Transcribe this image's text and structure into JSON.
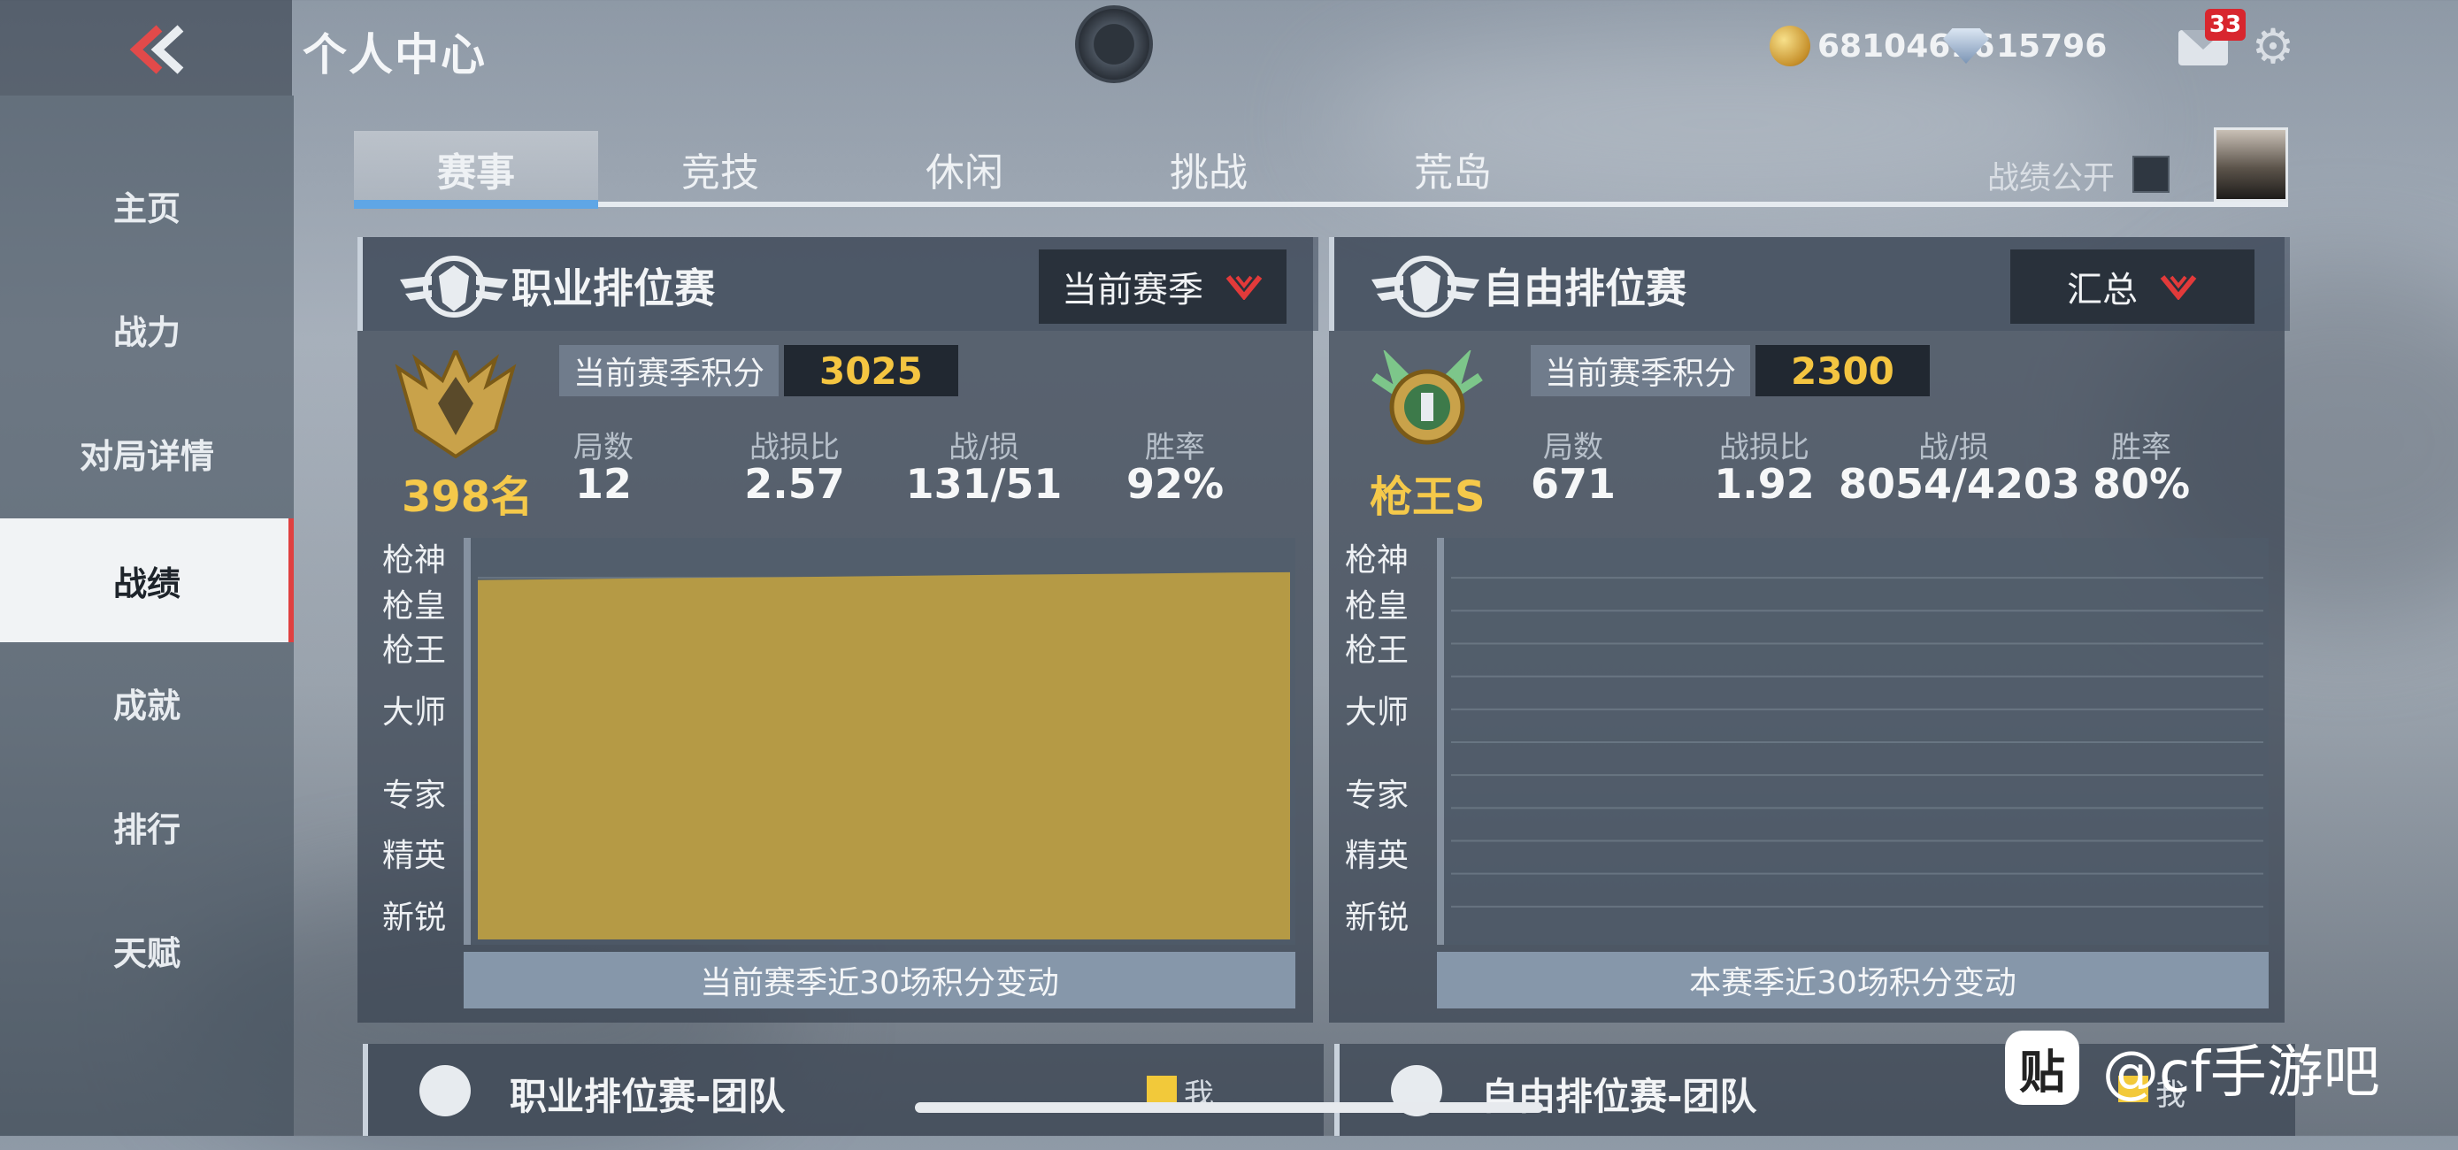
{
  "header": {
    "title": "个人中心",
    "coins": "68104616",
    "diamonds": "15796",
    "mail_badge": "33"
  },
  "sidebar": {
    "items": [
      {
        "label": "主页"
      },
      {
        "label": "战力"
      },
      {
        "label": "对局详情"
      },
      {
        "label": "战绩",
        "active": true
      },
      {
        "label": "成就"
      },
      {
        "label": "排行"
      },
      {
        "label": "天赋"
      }
    ]
  },
  "tabs": {
    "items": [
      {
        "label": "赛事",
        "active": true
      },
      {
        "label": "竞技"
      },
      {
        "label": "休闲"
      },
      {
        "label": "挑战"
      },
      {
        "label": "荒岛"
      }
    ],
    "public_label": "战绩公开"
  },
  "panels": [
    {
      "title": "职业排位赛",
      "dropdown": "当前赛季",
      "rank_text": "398名",
      "score_label": "当前赛季积分",
      "score": "3025",
      "stats": [
        {
          "label": "局数",
          "value": "12"
        },
        {
          "label": "战损比",
          "value": "2.57"
        },
        {
          "label": "战/损",
          "value": "131/51"
        },
        {
          "label": "胜率",
          "value": "92%"
        }
      ],
      "tiers": [
        "枪神",
        "枪皇",
        "枪王",
        "大师",
        "专家",
        "精英",
        "新锐"
      ],
      "caption": "当前赛季近30场积分变动"
    },
    {
      "title": "自由排位赛",
      "dropdown": "汇总",
      "rank_text": "枪王S",
      "score_label": "当前赛季积分",
      "score": "2300",
      "stats": [
        {
          "label": "局数",
          "value": "671"
        },
        {
          "label": "战损比",
          "value": "1.92"
        },
        {
          "label": "战/损",
          "value": "8054/4203"
        },
        {
          "label": "胜率",
          "value": "80%"
        }
      ],
      "tiers": [
        "枪神",
        "枪皇",
        "枪王",
        "大师",
        "专家",
        "精英",
        "新锐"
      ],
      "caption": "本赛季近30场积分变动"
    }
  ],
  "bottom_panels": [
    {
      "title": "职业排位赛-团队",
      "legend": "我"
    },
    {
      "title": "自由排位赛-团队",
      "legend": "我"
    }
  ],
  "chart_data": {
    "type": "area",
    "title": "当前赛季近30场积分变动",
    "categories": [
      "枪神",
      "枪皇",
      "枪王",
      "大师",
      "专家",
      "精英",
      "新锐"
    ],
    "x": [
      1,
      4,
      8,
      12,
      16,
      20,
      24,
      28,
      30
    ],
    "series": [
      {
        "values": [
          2960,
          2968,
          2978,
          2985,
          2995,
          3005,
          3012,
          3022,
          3025
        ]
      }
    ],
    "fill_color": "#b59a45"
  },
  "watermark": {
    "icon_glyph": "贴",
    "text": "@cf手游吧"
  }
}
